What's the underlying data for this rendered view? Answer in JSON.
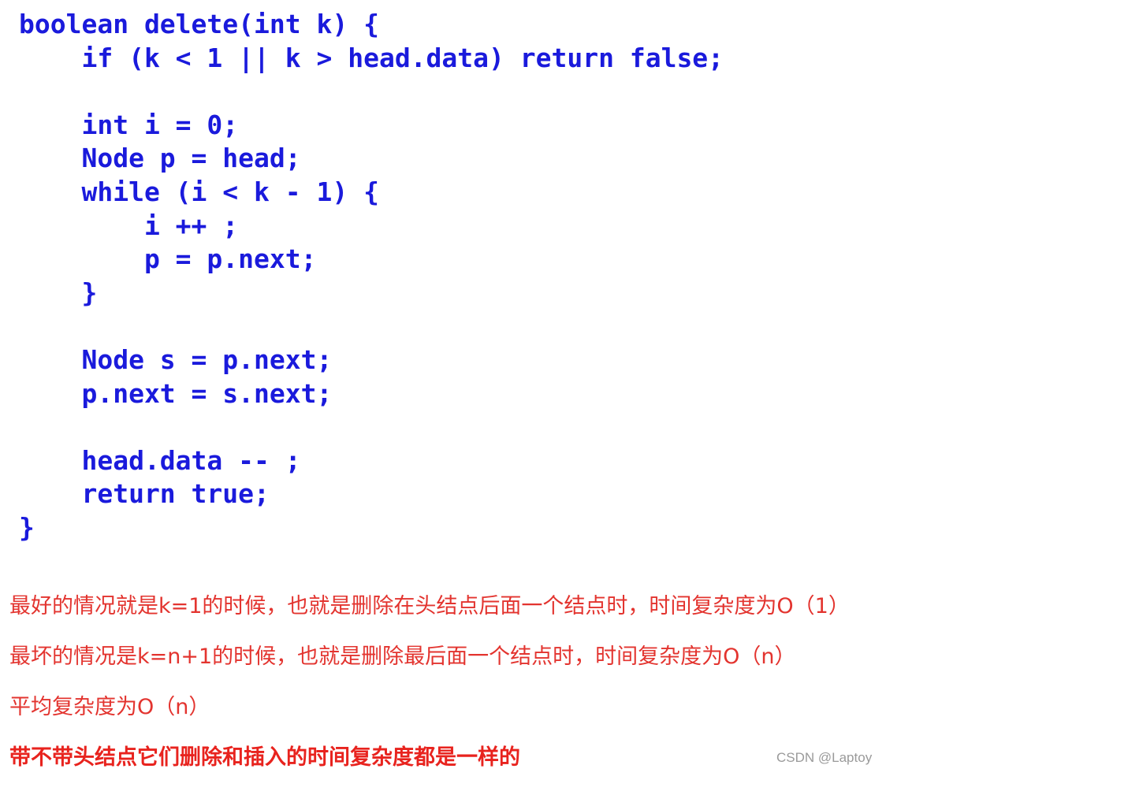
{
  "code": [
    "boolean delete(int k) {",
    "    if (k < 1 || k > head.data) return false;",
    "",
    "    int i = 0;",
    "    Node p = head;",
    "    while (i < k - 1) {",
    "        i ++ ;",
    "        p = p.next;",
    "    }",
    "",
    "    Node s = p.next;",
    "    p.next = s.next;",
    "",
    "    head.data -- ;",
    "    return true;",
    "}"
  ],
  "notes": {
    "best_case": "最好的情况就是k=1的时候，也就是删除在头结点后面一个结点时，时间复杂度为O（1）",
    "worst_case": "最坏的情况是k=n+1的时候，也就是删除最后面一个结点时，时间复杂度为O（n）",
    "average": "平均复杂度为O（n）",
    "conclusion": "带不带头结点它们删除和插入的时间复杂度都是一样的"
  },
  "watermark": "CSDN @Laptoy",
  "colors": {
    "code_text": "#1a1adc",
    "note_text": "#e3342f",
    "background": "#ffffff"
  }
}
